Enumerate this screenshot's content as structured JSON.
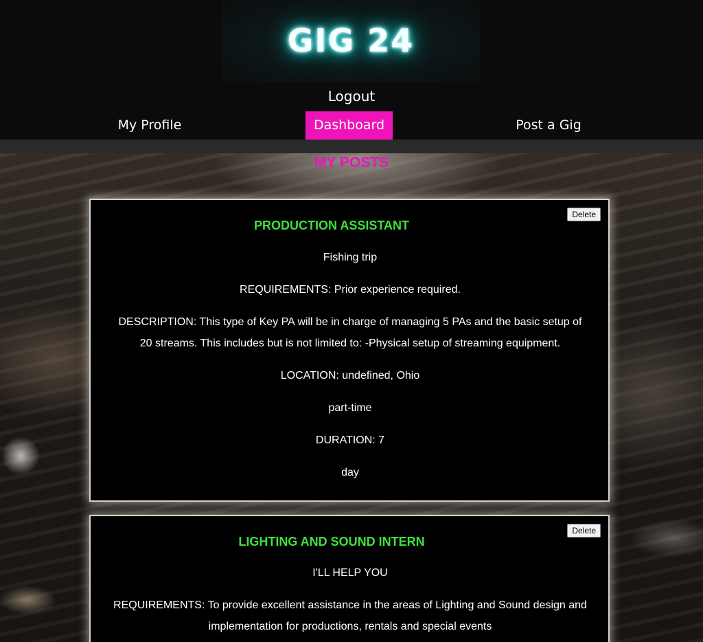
{
  "header": {
    "logo_text": "GIG 24",
    "logout_label": "Logout"
  },
  "nav": {
    "profile_label": "My Profile",
    "dashboard_label": "Dashboard",
    "post_label": "Post a Gig"
  },
  "main": {
    "title": "MY POSTS",
    "posts": [
      {
        "delete_label": "Delete",
        "title": "PRODUCTION ASSISTANT",
        "summary": "Fishing trip",
        "requirements": "REQUIREMENTS: Prior experience required.",
        "description": "DESCRIPTION: This type of Key PA will be in charge of managing 5 PAs and the basic setup of 20 streams. This includes but is not limited to: -Physical setup of streaming equipment.",
        "location": "LOCATION: undefined, Ohio",
        "type": "part-time",
        "duration": "DURATION: 7",
        "unit": "day"
      },
      {
        "delete_label": "Delete",
        "title": "LIGHTING AND SOUND INTERN",
        "summary": "I'LL HELP YOU",
        "requirements": "REQUIREMENTS: To provide excellent assistance in the areas of Lighting and Sound design and implementation for productions, rentals and special events"
      }
    ]
  },
  "colors": {
    "accent": "#ee14ba",
    "title_green": "#3ee03e",
    "logo_glow": "#1cc"
  }
}
